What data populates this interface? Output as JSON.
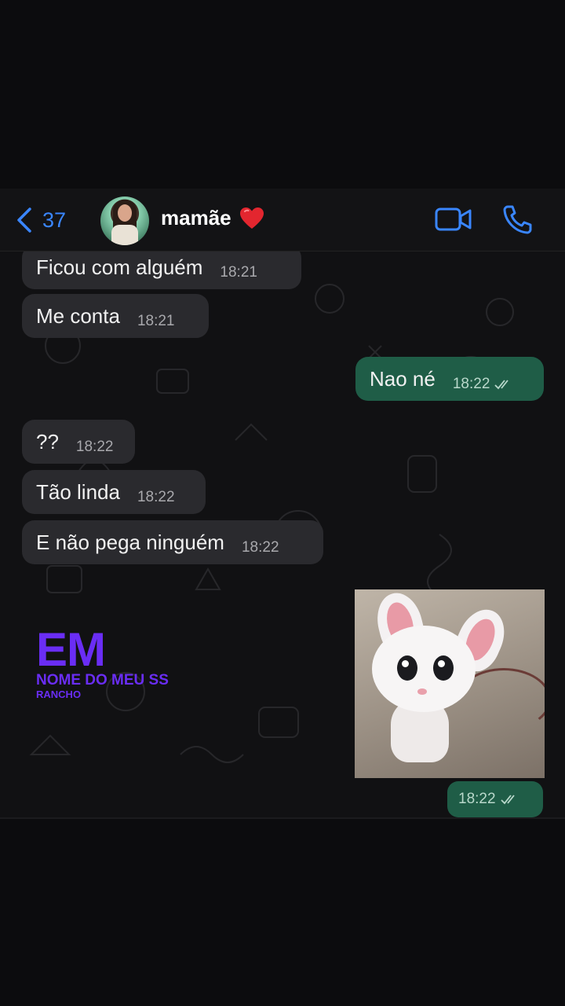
{
  "header": {
    "back_count": "37",
    "contact_name": "mamãe",
    "contact_emoji_icon": "red-heart-icon",
    "video_icon": "video-camera-icon",
    "call_icon": "phone-icon"
  },
  "messages": [
    {
      "direction": "in",
      "text": "Ficou com alguém",
      "time": "18:21"
    },
    {
      "direction": "in",
      "text": "Me conta",
      "time": "18:21"
    },
    {
      "direction": "out",
      "text": "Nao né",
      "time": "18:22",
      "status": "read"
    },
    {
      "direction": "in",
      "text": "??",
      "time": "18:22"
    },
    {
      "direction": "in",
      "text": "Tão linda",
      "time": "18:22"
    },
    {
      "direction": "in",
      "text": "E não pega ninguém",
      "time": "18:22"
    },
    {
      "direction": "out",
      "type": "image",
      "image_subject": "white cartoon bunny sticker",
      "time": "18:22",
      "status": "read"
    }
  ],
  "watermark": {
    "big": "EM",
    "line1": "NOME DO MEU SS",
    "line2": "RANCHO"
  },
  "colors": {
    "accent": "#3a86ff",
    "incoming_bubble": "#2a2a2e",
    "outgoing_bubble": "#1f5d47",
    "watermark": "#6a2df5"
  }
}
